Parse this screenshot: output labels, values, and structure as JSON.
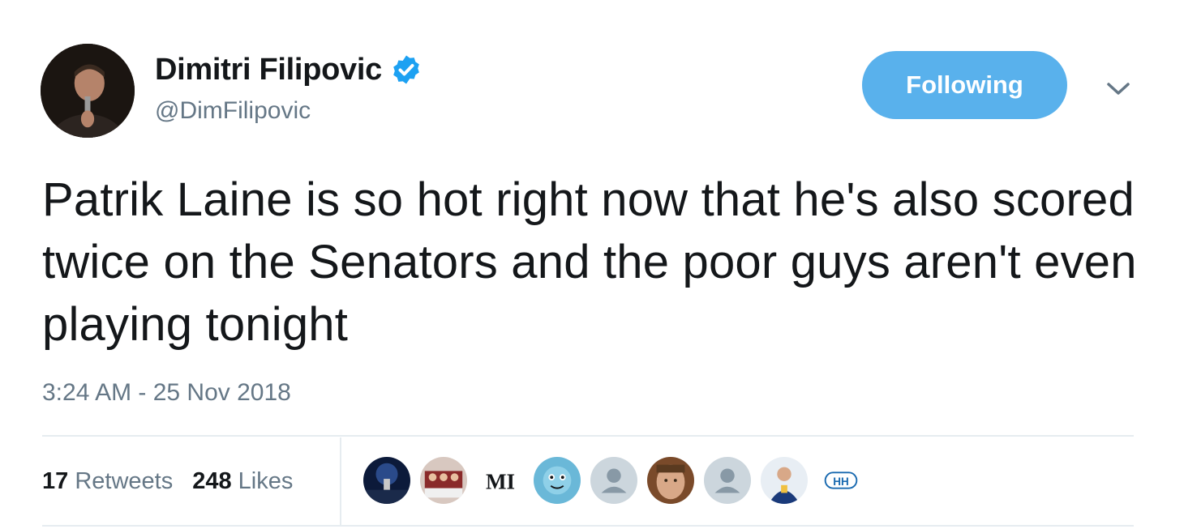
{
  "user": {
    "display_name": "Dimitri Filipovic",
    "handle": "@DimFilipovic",
    "verified": true
  },
  "follow_button": {
    "label": "Following",
    "color": "#59b1ec"
  },
  "tweet": {
    "text": "Patrik Laine is so hot right now that he's also scored twice on the Senators and the poor guys aren't even playing tonight",
    "timestamp": "3:24 AM - 25 Nov 2018"
  },
  "stats": {
    "retweets_count": "17",
    "retweets_label": "Retweets",
    "likes_count": "248",
    "likes_label": "Likes"
  },
  "likers": [
    {
      "icon": "night-sky-avatar"
    },
    {
      "icon": "team-photo-avatar"
    },
    {
      "icon": "mi-logo-avatar",
      "text": "MI"
    },
    {
      "icon": "cartoon-avatar"
    },
    {
      "icon": "default-user-avatar"
    },
    {
      "icon": "face-photo-avatar"
    },
    {
      "icon": "default-user-avatar"
    },
    {
      "icon": "player-photo-avatar"
    },
    {
      "icon": "hh-logo-avatar",
      "text": "HH"
    }
  ],
  "colors": {
    "text": "#14171a",
    "muted": "#657786",
    "accent": "#1da1f2",
    "divider": "#e6ecf0"
  }
}
